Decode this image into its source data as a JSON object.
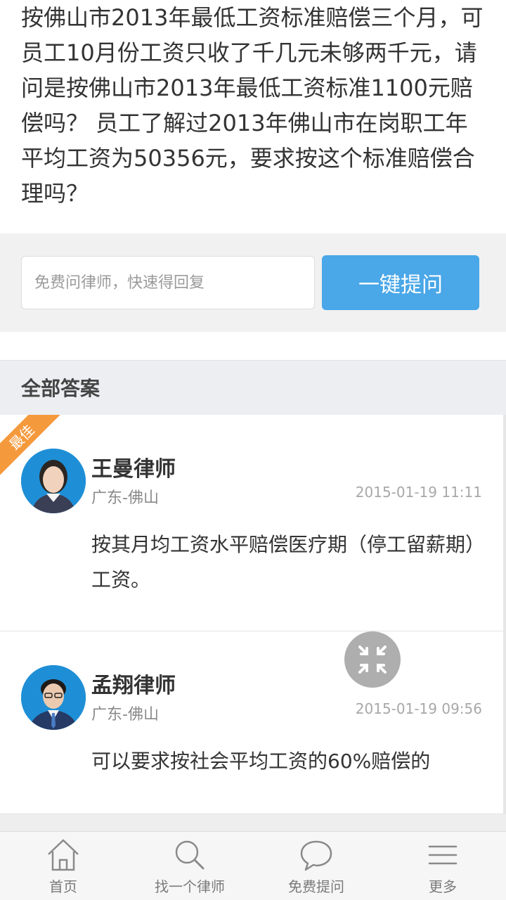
{
  "question": {
    "text": "按佛山市2013年最低工资标准赔偿三个月，可员工10月份工资只收了千几元未够两千元，请问是按佛山市2013年最低工资标准1100元赔偿吗？ 员工了解过2013年佛山市在岗职工年平均工资为50356元，要求按这个标准赔偿合理吗？"
  },
  "ask": {
    "placeholder": "免费问律师，快速得回复",
    "button_label": "一键提问"
  },
  "answers": {
    "title": "全部答案",
    "items": [
      {
        "badge": "最佳",
        "name": "王曼律师",
        "location": "广东-佛山",
        "time": "2015-01-19 11:11",
        "text": "按其月均工资水平赔偿医疗期（停工留薪期）工资。"
      },
      {
        "name": "孟翔律师",
        "location": "广东-佛山",
        "time": "2015-01-19 09:56",
        "text": "可以要求按社会平均工资的60%赔偿的"
      }
    ]
  },
  "floating": {
    "icon": "collapse-arrows-icon"
  },
  "nav": {
    "items": [
      {
        "label": "首页",
        "icon": "home-icon"
      },
      {
        "label": "找一个律师",
        "icon": "search-icon"
      },
      {
        "label": "免费提问",
        "icon": "chat-bubble-icon"
      },
      {
        "label": "更多",
        "icon": "menu-icon"
      }
    ]
  },
  "colors": {
    "accent": "#4aa7e8",
    "ribbon": "#f59a3c",
    "header_bg": "#eceef2"
  }
}
